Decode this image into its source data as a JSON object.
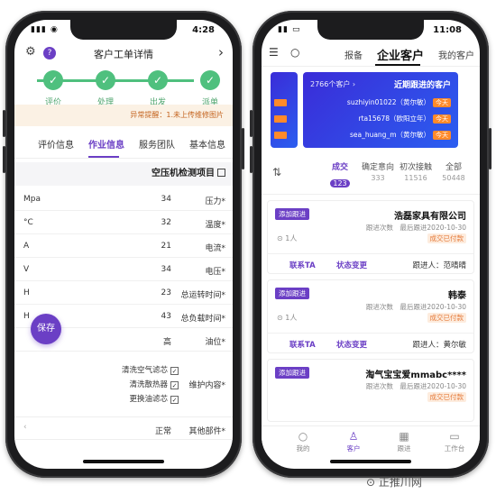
{
  "left": {
    "status": {
      "time": "4:28",
      "icons": "▮▮▮ ◉"
    },
    "header": {
      "title": "客户工单详情",
      "back": "›",
      "gear": "⚙",
      "badge": "?"
    },
    "steps": [
      {
        "label": "派单",
        "check": "✓"
      },
      {
        "label": "出发",
        "check": "✓"
      },
      {
        "label": "处理",
        "check": "✓"
      },
      {
        "label": "评价",
        "check": "✓"
      }
    ],
    "warning": "异常提醒：1.未上传维修图片",
    "tabs": [
      "基本信息",
      "服务团队",
      "作业信息",
      "评价信息"
    ],
    "active_tab": 2,
    "section_title": "空压机检测项目",
    "params": [
      {
        "label": "压力*",
        "value": "34",
        "unit": "Mpa"
      },
      {
        "label": "温度*",
        "value": "32",
        "unit": "°C"
      },
      {
        "label": "电流*",
        "value": "21",
        "unit": "A"
      },
      {
        "label": "电压*",
        "value": "34",
        "unit": "V"
      },
      {
        "label": "总运转时间*",
        "value": "23",
        "unit": "H"
      },
      {
        "label": "总负载时间*",
        "value": "43",
        "unit": "H"
      },
      {
        "label": "油位*",
        "value": "高",
        "unit": ""
      }
    ],
    "save_label": "保存",
    "maintenance": {
      "label": "维护内容*",
      "options": [
        "清洗空气滤芯",
        "清洗散热器",
        "更换油滤芯"
      ]
    },
    "other": {
      "label": "其他部件*",
      "value": "正常",
      "chev": "‹"
    }
  },
  "right": {
    "status": {
      "time": "11:08",
      "icons": "▮▮ ▭"
    },
    "nav": {
      "mine": "我的客户",
      "enterprise": "企业客户",
      "report": "报备",
      "search_icon": "○",
      "menu_icon": "☰"
    },
    "banner": {
      "title": "近期跟进的客户",
      "count": "2766个客户 ›",
      "lines": [
        {
          "text": "suzhiyin01022（黄尔敏）",
          "tag": "今天"
        },
        {
          "text": "rta15678（欧阳立年）",
          "tag": "今天"
        },
        {
          "text": "sea_huang_m（黄尔敏）",
          "tag": "今天"
        }
      ]
    },
    "stats": [
      {
        "label": "全部",
        "num": "50448"
      },
      {
        "label": "初次接触",
        "num": "11516"
      },
      {
        "label": "确定意向",
        "num": "333"
      },
      {
        "label": "成交",
        "num": "123"
      }
    ],
    "active_stat": 3,
    "cards": [
      {
        "name": "浩磊家具有限公司",
        "tag": "添加跟进",
        "info": "跟进次数　最后跟进2020-10-30",
        "status": "成交已付款",
        "user": "⊙ 1人",
        "follower": "跟进人：范晴晴",
        "act1": "状态变更",
        "act2": "联系TA"
      },
      {
        "name": "韩泰",
        "tag": "添加跟进",
        "info": "跟进次数　最后跟进2020-10-30",
        "status": "成交已付款",
        "user": "⊙ 1人",
        "follower": "跟进人：黄尔敏",
        "act1": "状态变更",
        "act2": "联系TA"
      },
      {
        "name": "淘气宝宝爱mmabc****",
        "tag": "添加跟进",
        "info": "跟进次数　最后跟进2020-10-30",
        "status": "成交已付款",
        "user": "",
        "follower": "",
        "act1": "",
        "act2": ""
      }
    ],
    "tabbar": [
      {
        "label": "工作台",
        "icon": "▭"
      },
      {
        "label": "跟进",
        "icon": "▦"
      },
      {
        "label": "客户",
        "icon": "♙"
      },
      {
        "label": "我的",
        "icon": "○"
      }
    ],
    "active_tabbar": 2
  },
  "watermark": "⊙ 正推川网"
}
